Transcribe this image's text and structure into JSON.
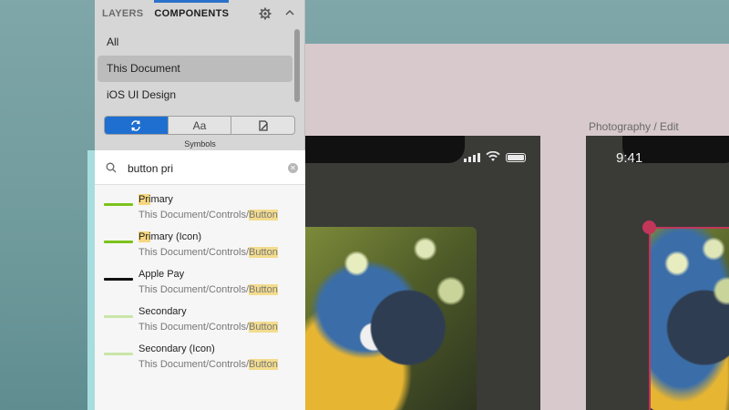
{
  "canvas": {
    "artboard_label": "Photography / Edit",
    "status_time": "9:41"
  },
  "inspector": {
    "tabs": [
      {
        "label": "LAYERS",
        "active": false
      },
      {
        "label": "COMPONENTS",
        "active": true
      }
    ],
    "documents": [
      {
        "label": "All",
        "selected": false
      },
      {
        "label": "This Document",
        "selected": true
      },
      {
        "label": "iOS UI Design",
        "selected": false
      }
    ],
    "segments": [
      {
        "icon": "symbols-icon",
        "active": true
      },
      {
        "label": "Aa",
        "active": false
      },
      {
        "icon": "layer-styles-icon",
        "active": false
      }
    ],
    "segment_caption": "Symbols"
  },
  "search": {
    "query": "button pri",
    "results": [
      {
        "title_match": "Pri",
        "title_rest": "mary",
        "path_prefix": "This Document/Controls/",
        "path_match": "Button",
        "swatch": "#7cc21c"
      },
      {
        "title_match": "Pri",
        "title_rest": "mary (Icon)",
        "path_prefix": "This Document/Controls/",
        "path_match": "Button",
        "swatch": "#7cc21c"
      },
      {
        "title_match": "",
        "title_rest": "Apple Pay",
        "path_prefix": "This Document/Controls/",
        "path_match": "Button",
        "swatch": "#111111"
      },
      {
        "title_match": "",
        "title_rest": "Secondary",
        "path_prefix": "This Document/Controls/",
        "path_match": "Button",
        "swatch": "#c9e5a8"
      },
      {
        "title_match": "",
        "title_rest": "Secondary (Icon)",
        "path_prefix": "This Document/Controls/",
        "path_match": "Button",
        "swatch": "#c9e5a8"
      }
    ]
  }
}
